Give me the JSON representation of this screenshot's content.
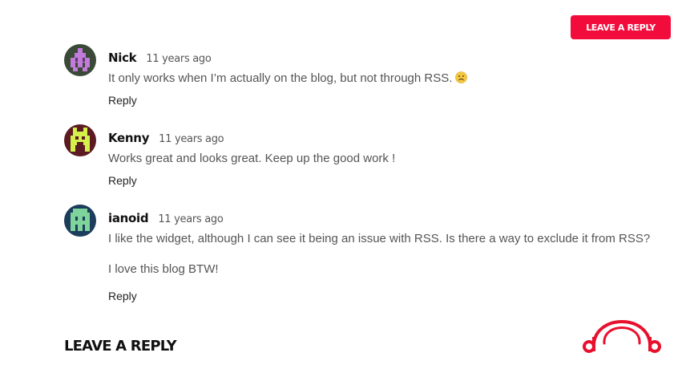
{
  "header": {
    "leave_reply_button": "LEAVE A REPLY"
  },
  "comments": [
    {
      "author": "Nick",
      "time": "11 years ago",
      "paragraphs": [
        "It only works when I’m actually on the blog, but not through RSS."
      ],
      "has_emoji": true,
      "emoji": "sad-face-icon",
      "reply_label": "Reply",
      "avatar_bg": "#3a4a36",
      "avatar_fg": "#c27adb"
    },
    {
      "author": "Kenny",
      "time": "11 years ago",
      "paragraphs": [
        "Works great and looks great. Keep up the good work !"
      ],
      "reply_label": "Reply",
      "avatar_bg": "#5c1a22",
      "avatar_fg": "#d4f04a"
    },
    {
      "author": "ianoid",
      "time": "11 years ago",
      "paragraphs": [
        "I like the widget, although I can see it being an issue with RSS. Is there a way to exclude it from RSS?",
        "I love this blog BTW!"
      ],
      "reply_label": "Reply",
      "avatar_bg": "#1c3d5c",
      "avatar_fg": "#7ed49a"
    }
  ],
  "reply_section": {
    "title": "LEAVE A REPLY"
  },
  "brand": {
    "logo_icon": "headphones-logo-icon",
    "accent": "#e8112d"
  }
}
